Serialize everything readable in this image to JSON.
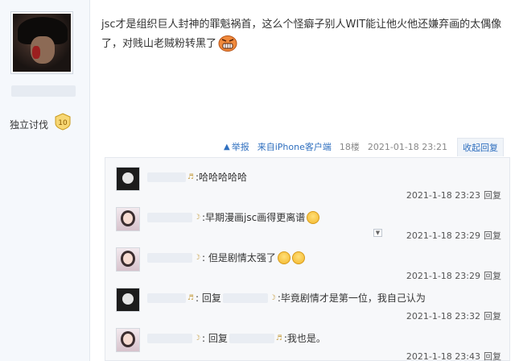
{
  "user": {
    "title_tag": "独立讨伐",
    "level": "10"
  },
  "post": {
    "text": "jsc才是组织巨人封神的罪魁祸首，这么个怪癖子别人WIT能让他火他还嫌弃画的太偶像了，对贱山老贼粉转黑了",
    "meta": {
      "report": "举报",
      "client": "来自iPhone客户端",
      "floor": "18楼",
      "datetime": "2021-01-18 23:21",
      "collapse_reply": "收起回复"
    }
  },
  "comments": [
    {
      "avatar": "dark",
      "prefix": "",
      "mention": false,
      "text": ":哈哈哈哈哈",
      "laughs": 0,
      "time": "2021-1-18 23:23",
      "reply": "回复"
    },
    {
      "avatar": "light",
      "prefix": "",
      "mention": false,
      "text": ":早期漫画jsc画得更离谱",
      "laughs": 1,
      "time": "2021-1-18 23:29",
      "reply": "回复"
    },
    {
      "avatar": "light",
      "prefix": "",
      "mention": false,
      "text": ": 但是剧情太强了",
      "laughs": 2,
      "time": "2021-1-18 23:29",
      "reply": "回复"
    },
    {
      "avatar": "dark",
      "prefix": ": 回复",
      "mention": true,
      "text": ":毕竟剧情才是第一位，我自己认为",
      "laughs": 0,
      "time": "2021-1-18 23:32",
      "reply": "回复"
    },
    {
      "avatar": "light",
      "prefix": ": 回复",
      "mention": true,
      "text": ":我也是。",
      "laughs": 0,
      "time": "2021-1-18 23:43",
      "reply": "回复"
    }
  ],
  "colors": {
    "link": "#2f6fbf",
    "comment_bg": "#f7f8fa"
  }
}
